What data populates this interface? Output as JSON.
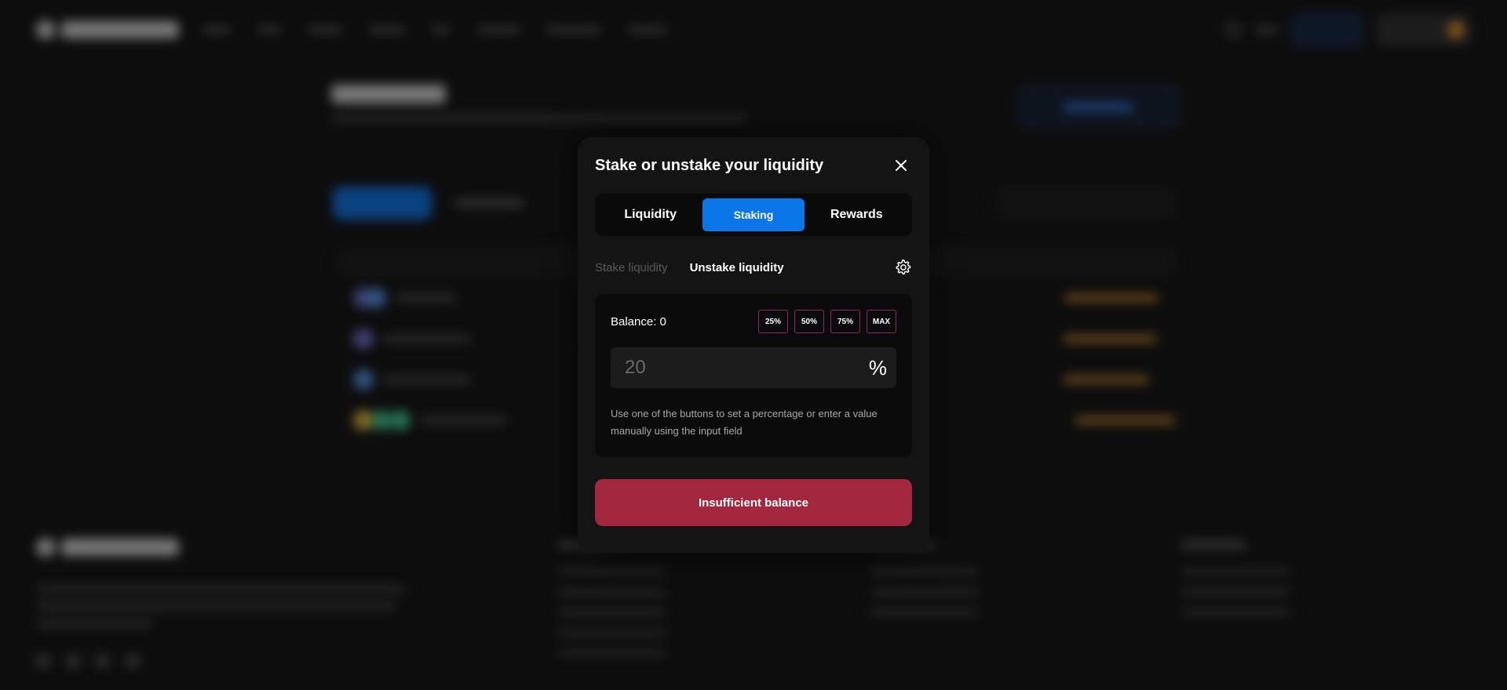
{
  "modal": {
    "title": "Stake or unstake your liquidity",
    "tabs": [
      {
        "label": "Liquidity",
        "active": false
      },
      {
        "label": "Staking",
        "active": true
      },
      {
        "label": "Rewards",
        "active": false
      }
    ],
    "subtabs": [
      {
        "label": "Stake liquidity",
        "active": false
      },
      {
        "label": "Unstake liquidity",
        "active": true
      }
    ],
    "balance_label": "Balance: 0",
    "percent_buttons": [
      "25%",
      "50%",
      "75%",
      "MAX"
    ],
    "amount_input": {
      "value": "",
      "placeholder": "20"
    },
    "percent_sign": "%",
    "hint": "Use one of the buttons to set a percentage or enter a value manually using the input field",
    "submit_label": "Insufficient balance"
  },
  "icons": {
    "close": "close-icon",
    "settings": "gear-icon"
  },
  "colors": {
    "accent_blue": "#0a76e8",
    "danger": "#a3263f",
    "percent_border": "#8a2c54",
    "modal_bg": "#141414"
  }
}
